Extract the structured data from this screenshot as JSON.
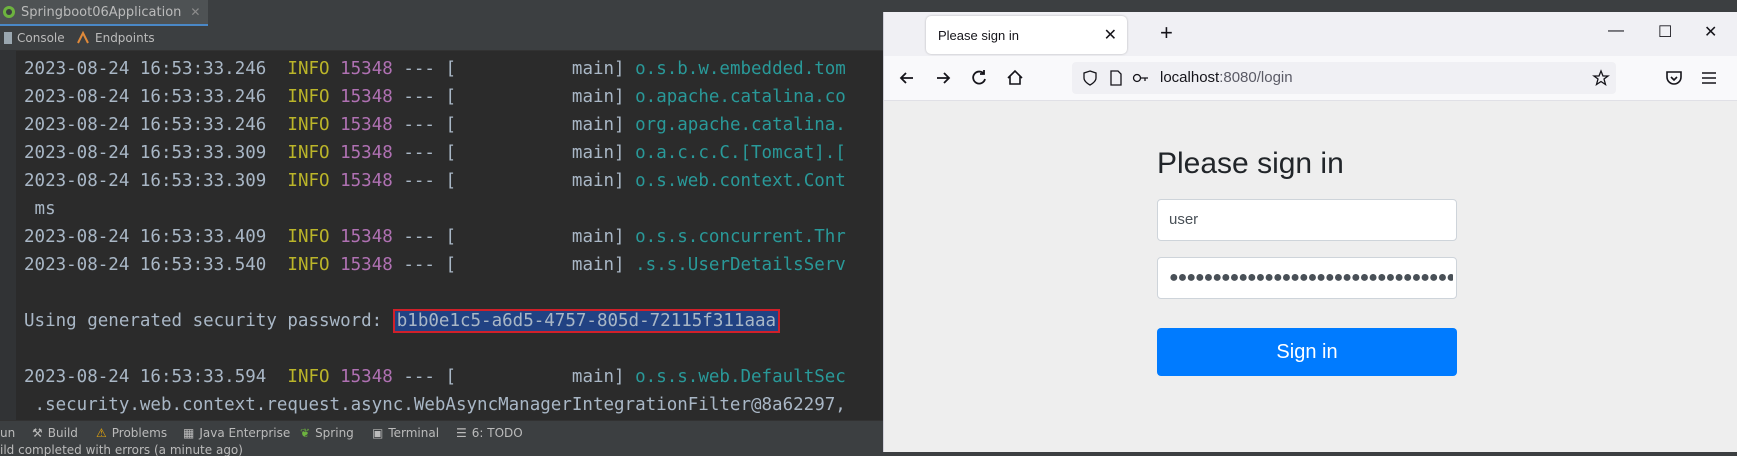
{
  "ide": {
    "run_tab_label": "Springboot06Application",
    "sub_tabs": [
      "Console",
      "Endpoints"
    ],
    "console_lines": [
      {
        "ts": "2023-08-24 16:53:33.246",
        "level": "INFO",
        "pid": "15348",
        "sep": " --- [",
        "thread": "           main]",
        "cls": " o.s.b.w.embedded.tom"
      },
      {
        "ts": "2023-08-24 16:53:33.246",
        "level": "INFO",
        "pid": "15348",
        "sep": " --- [",
        "thread": "           main]",
        "cls": " o.apache.catalina.co"
      },
      {
        "ts": "2023-08-24 16:53:33.246",
        "level": "INFO",
        "pid": "15348",
        "sep": " --- [",
        "thread": "           main]",
        "cls": " org.apache.catalina."
      },
      {
        "ts": "2023-08-24 16:53:33.309",
        "level": "INFO",
        "pid": "15348",
        "sep": " --- [",
        "thread": "           main]",
        "cls": " o.a.c.c.C.[Tomcat].["
      },
      {
        "ts": "2023-08-24 16:53:33.309",
        "level": "INFO",
        "pid": "15348",
        "sep": " --- [",
        "thread": "           main]",
        "cls": " o.s.web.context.Cont"
      },
      {
        "ts": "2023-08-24 16:53:33.409",
        "level": "INFO",
        "pid": "15348",
        "sep": " --- [",
        "thread": "           main]",
        "cls": " o.s.s.concurrent.Thr"
      },
      {
        "ts": "2023-08-24 16:53:33.540",
        "level": "INFO",
        "pid": "15348",
        "sep": " --- [",
        "thread": "           main]",
        "cls": " .s.s.UserDetailsServ"
      },
      {
        "ts": "2023-08-24 16:53:33.594",
        "level": "INFO",
        "pid": "15348",
        "sep": " --- [",
        "thread": "           main]",
        "cls": " o.s.s.web.DefaultSec"
      }
    ],
    "wrap_ms": " ms",
    "password_label": "Using generated security password: ",
    "password_value": "b1b0e1c5-a6d5-4757-805d-72115f311aaa",
    "wrap_filter": " .security.web.context.request.async.WebAsyncManagerIntegrationFilter@8a62297,",
    "bottom_tabs": [
      "un",
      "Build",
      "Problems",
      "Java Enterprise",
      "Spring",
      "Terminal",
      "6: TODO"
    ],
    "status_text": "ild completed with errors (a minute ago)"
  },
  "browser": {
    "tab_title": "Please sign in",
    "url_host": "localhost",
    "url_rest": ":8080/login",
    "heading": "Please sign in",
    "username_value": "user",
    "password_masked": "●●●●●●●●●●●●●●●●●●●●●●●●●●●●●●●●●●●●",
    "submit_label": "Sign in"
  },
  "colors": {
    "accent": "#007bff",
    "highlight_border": "#d0202a"
  }
}
